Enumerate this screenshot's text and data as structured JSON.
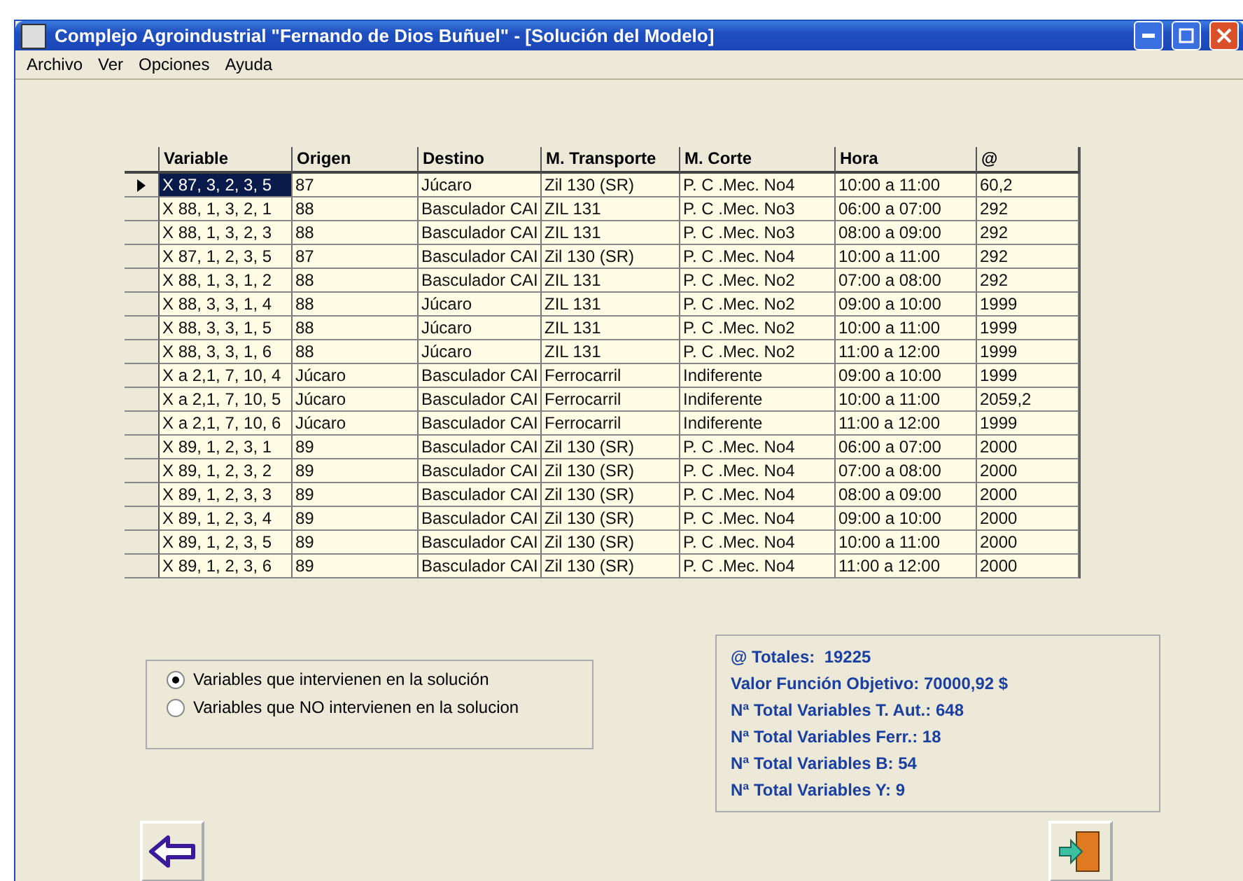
{
  "window": {
    "title": "Complejo Agroindustrial \"Fernando de Dios Buñuel\" - [Solución del Modelo]"
  },
  "menu": [
    "Archivo",
    "Ver",
    "Opciones",
    "Ayuda"
  ],
  "table": {
    "columns": [
      "Variable",
      "Origen",
      "Destino",
      "M. Transporte",
      "M. Corte",
      "Hora",
      "@"
    ],
    "rows": [
      {
        "selected": true,
        "cells": [
          "X 87, 3, 2, 3, 5",
          "87",
          "Júcaro",
          "Zil 130 (SR)",
          "P. C .Mec. No4",
          "10:00 a 11:00",
          "60,2"
        ]
      },
      {
        "selected": false,
        "cells": [
          "X 88, 1, 3, 2, 1",
          "88",
          "Basculador CAI",
          "ZIL 131",
          "P. C .Mec. No3",
          "06:00 a 07:00",
          "292"
        ]
      },
      {
        "selected": false,
        "cells": [
          "X 88, 1, 3, 2, 3",
          "88",
          "Basculador CAI",
          "ZIL 131",
          "P. C .Mec. No3",
          "08:00 a 09:00",
          "292"
        ]
      },
      {
        "selected": false,
        "cells": [
          "X 87, 1, 2, 3, 5",
          "87",
          "Basculador CAI",
          "Zil 130 (SR)",
          "P. C .Mec. No4",
          "10:00 a 11:00",
          "292"
        ]
      },
      {
        "selected": false,
        "cells": [
          "X 88, 1, 3, 1, 2",
          "88",
          "Basculador CAI",
          "ZIL 131",
          "P. C .Mec. No2",
          "07:00 a 08:00",
          "292"
        ]
      },
      {
        "selected": false,
        "cells": [
          "X 88, 3, 3, 1, 4",
          "88",
          "Júcaro",
          "ZIL 131",
          "P. C .Mec. No2",
          "09:00 a 10:00",
          "1999"
        ]
      },
      {
        "selected": false,
        "cells": [
          "X 88, 3, 3, 1, 5",
          "88",
          "Júcaro",
          "ZIL 131",
          "P. C .Mec. No2",
          "10:00 a 11:00",
          "1999"
        ]
      },
      {
        "selected": false,
        "cells": [
          "X 88, 3, 3, 1, 6",
          "88",
          "Júcaro",
          "ZIL 131",
          "P. C .Mec. No2",
          "11:00 a 12:00",
          "1999"
        ]
      },
      {
        "selected": false,
        "cells": [
          "X a 2,1, 7, 10, 4",
          "Júcaro",
          "Basculador CAI",
          "Ferrocarril",
          "Indiferente",
          "09:00 a 10:00",
          "1999"
        ]
      },
      {
        "selected": false,
        "cells": [
          "X a 2,1, 7, 10, 5",
          "Júcaro",
          "Basculador CAI",
          "Ferrocarril",
          "Indiferente",
          "10:00 a 11:00",
          "2059,2"
        ]
      },
      {
        "selected": false,
        "cells": [
          "X a 2,1, 7, 10, 6",
          "Júcaro",
          "Basculador CAI",
          "Ferrocarril",
          "Indiferente",
          "11:00 a 12:00",
          "1999"
        ]
      },
      {
        "selected": false,
        "cells": [
          "X 89, 1, 2, 3, 1",
          "89",
          "Basculador CAI",
          "Zil 130 (SR)",
          "P. C .Mec. No4",
          "06:00 a 07:00",
          "2000"
        ]
      },
      {
        "selected": false,
        "cells": [
          "X 89, 1, 2, 3, 2",
          "89",
          "Basculador CAI",
          "Zil 130 (SR)",
          "P. C .Mec. No4",
          "07:00 a 08:00",
          "2000"
        ]
      },
      {
        "selected": false,
        "cells": [
          "X 89, 1, 2, 3, 3",
          "89",
          "Basculador CAI",
          "Zil 130 (SR)",
          "P. C .Mec. No4",
          "08:00 a 09:00",
          "2000"
        ]
      },
      {
        "selected": false,
        "cells": [
          "X 89, 1, 2, 3, 4",
          "89",
          "Basculador CAI",
          "Zil 130 (SR)",
          "P. C .Mec. No4",
          "09:00 a 10:00",
          "2000"
        ]
      },
      {
        "selected": false,
        "cells": [
          "X 89, 1, 2, 3, 5",
          "89",
          "Basculador CAI",
          "Zil 130 (SR)",
          "P. C .Mec. No4",
          "10:00 a 11:00",
          "2000"
        ]
      },
      {
        "selected": false,
        "cells": [
          "X 89, 1, 2, 3, 6",
          "89",
          "Basculador CAI",
          "Zil 130 (SR)",
          "P. C .Mec. No4",
          "11:00 a 12:00",
          "2000"
        ]
      }
    ]
  },
  "filter": [
    {
      "label": "Variables que intervienen en la solución",
      "selected": true
    },
    {
      "label": "Variables que NO intervienen en la solucion",
      "selected": false
    }
  ],
  "totals": [
    "@ Totales:  19225",
    "Valor Función Objetivo: 70000,92 $",
    "Nª Total Variables T. Aut.: 648",
    "Nª Total Variables Ferr.: 18",
    "Nª Total Variables B: 54",
    "Nª Total Variables Y: 9"
  ]
}
